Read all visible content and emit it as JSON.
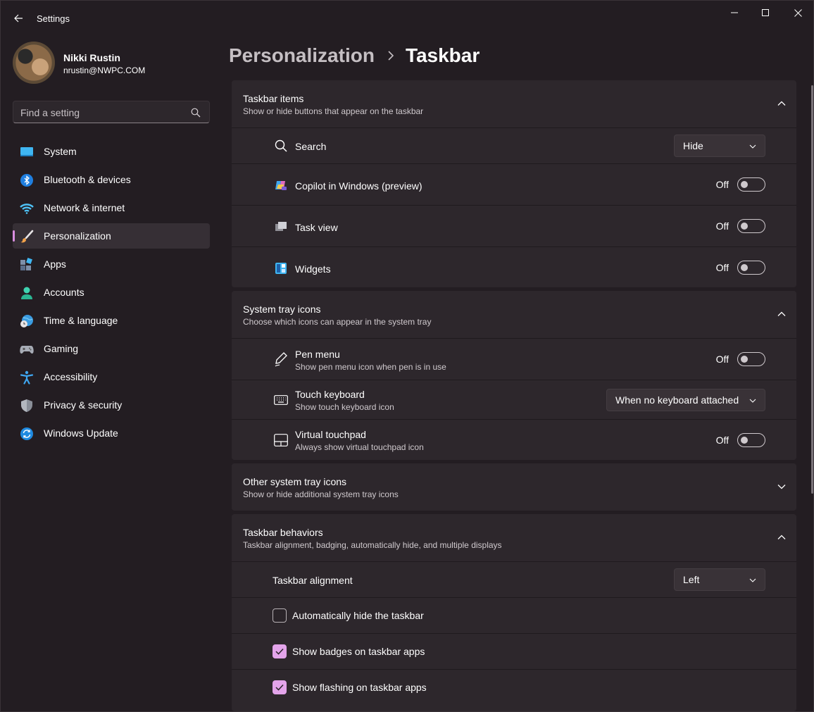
{
  "window": {
    "title": "Settings",
    "controls": {
      "minimize": "minimize-icon",
      "maximize": "maximize-icon",
      "close": "close-icon"
    }
  },
  "profile": {
    "name": "Nikki Rustin",
    "email": "nrustin@NWPC.COM"
  },
  "search": {
    "placeholder": "Find a setting",
    "value": ""
  },
  "sidebar": {
    "items": [
      {
        "label": "System",
        "icon": "system-icon",
        "active": false
      },
      {
        "label": "Bluetooth & devices",
        "icon": "bluetooth-icon",
        "active": false
      },
      {
        "label": "Network & internet",
        "icon": "wifi-icon",
        "active": false
      },
      {
        "label": "Personalization",
        "icon": "paintbrush-icon",
        "active": true
      },
      {
        "label": "Apps",
        "icon": "apps-icon",
        "active": false
      },
      {
        "label": "Accounts",
        "icon": "person-icon",
        "active": false
      },
      {
        "label": "Time & language",
        "icon": "globe-clock-icon",
        "active": false
      },
      {
        "label": "Gaming",
        "icon": "gamepad-icon",
        "active": false
      },
      {
        "label": "Accessibility",
        "icon": "accessibility-icon",
        "active": false
      },
      {
        "label": "Privacy & security",
        "icon": "shield-icon",
        "active": false
      },
      {
        "label": "Windows Update",
        "icon": "update-icon",
        "active": false
      }
    ]
  },
  "header": {
    "parent": "Personalization",
    "current": "Taskbar"
  },
  "sections": {
    "taskbar_items": {
      "title": "Taskbar items",
      "subtitle": "Show or hide buttons that appear on the taskbar",
      "expanded": true,
      "rows": {
        "search": {
          "label": "Search",
          "value": "Hide"
        },
        "copilot": {
          "label": "Copilot in Windows (preview)",
          "state": "Off"
        },
        "task_view": {
          "label": "Task view",
          "state": "Off"
        },
        "widgets": {
          "label": "Widgets",
          "state": "Off"
        }
      }
    },
    "system_tray": {
      "title": "System tray icons",
      "subtitle": "Choose which icons can appear in the system tray",
      "expanded": true,
      "rows": {
        "pen_menu": {
          "label": "Pen menu",
          "sub": "Show pen menu icon when pen is in use",
          "state": "Off"
        },
        "touch_keyboard": {
          "label": "Touch keyboard",
          "sub": "Show touch keyboard icon",
          "value": "When no keyboard attached"
        },
        "virtual_touchpad": {
          "label": "Virtual touchpad",
          "sub": "Always show virtual touchpad icon",
          "state": "Off"
        }
      }
    },
    "other_tray": {
      "title": "Other system tray icons",
      "subtitle": "Show or hide additional system tray icons",
      "expanded": false
    },
    "behaviors": {
      "title": "Taskbar behaviors",
      "subtitle": "Taskbar alignment, badging, automatically hide, and multiple displays",
      "expanded": true,
      "rows": {
        "alignment": {
          "label": "Taskbar alignment",
          "value": "Left"
        },
        "auto_hide": {
          "label": "Automatically hide the taskbar",
          "checked": false
        },
        "badges": {
          "label": "Show badges on taskbar apps",
          "checked": true
        },
        "flashing": {
          "label": "Show flashing on taskbar apps",
          "checked": true
        }
      }
    }
  },
  "colors": {
    "accent": "#e3a4ea",
    "background": "#231d22",
    "card": "#2d272c"
  }
}
